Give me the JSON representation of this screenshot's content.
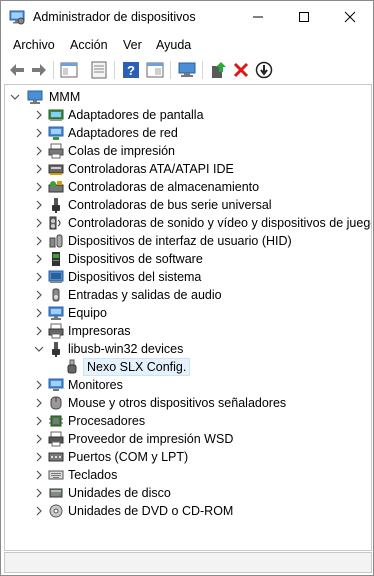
{
  "window": {
    "title": "Administrador de dispositivos"
  },
  "menu": [
    "Archivo",
    "Acción",
    "Ver",
    "Ayuda"
  ],
  "toolbar": [
    "back-icon",
    "forward-icon",
    "show-hide-tree-icon",
    "properties-icon",
    "help-icon",
    "view-icon",
    "computer-icon",
    "update-driver-icon",
    "uninstall-icon",
    "disable-device-icon"
  ],
  "tree": {
    "root": "MMM",
    "categories": [
      {
        "label": "Adaptadores de pantalla",
        "icon": "display-adapter-icon"
      },
      {
        "label": "Adaptadores de red",
        "icon": "network-adapter-icon"
      },
      {
        "label": "Colas de impresión",
        "icon": "print-queue-icon"
      },
      {
        "label": "Controladoras ATA/ATAPI IDE",
        "icon": "ide-controller-icon"
      },
      {
        "label": "Controladoras de almacenamiento",
        "icon": "storage-controller-icon"
      },
      {
        "label": "Controladoras de bus serie universal",
        "icon": "usb-icon"
      },
      {
        "label": "Controladoras de sonido y vídeo y dispositivos de juego",
        "icon": "sound-icon"
      },
      {
        "label": "Dispositivos de interfaz de usuario (HID)",
        "icon": "hid-icon"
      },
      {
        "label": "Dispositivos de software",
        "icon": "software-device-icon"
      },
      {
        "label": "Dispositivos del sistema",
        "icon": "system-device-icon"
      },
      {
        "label": "Entradas y salidas de audio",
        "icon": "audio-io-icon"
      },
      {
        "label": "Equipo",
        "icon": "computer-icon"
      },
      {
        "label": "Impresoras",
        "icon": "printer-icon"
      },
      {
        "label": "libusb-win32 devices",
        "icon": "usb-icon",
        "expanded": true,
        "children": [
          {
            "label": "Nexo SLX Config.",
            "icon": "usb-device-icon",
            "selected": true
          }
        ]
      },
      {
        "label": "Monitores",
        "icon": "monitor-icon"
      },
      {
        "label": "Mouse y otros dispositivos señaladores",
        "icon": "mouse-icon"
      },
      {
        "label": "Procesadores",
        "icon": "processor-icon"
      },
      {
        "label": "Proveedor de impresión WSD",
        "icon": "wsd-printer-icon"
      },
      {
        "label": "Puertos (COM y LPT)",
        "icon": "port-icon"
      },
      {
        "label": "Teclados",
        "icon": "keyboard-icon"
      },
      {
        "label": "Unidades de disco",
        "icon": "disk-drive-icon"
      },
      {
        "label": "Unidades de DVD o CD-ROM",
        "icon": "dvd-drive-icon"
      }
    ]
  }
}
